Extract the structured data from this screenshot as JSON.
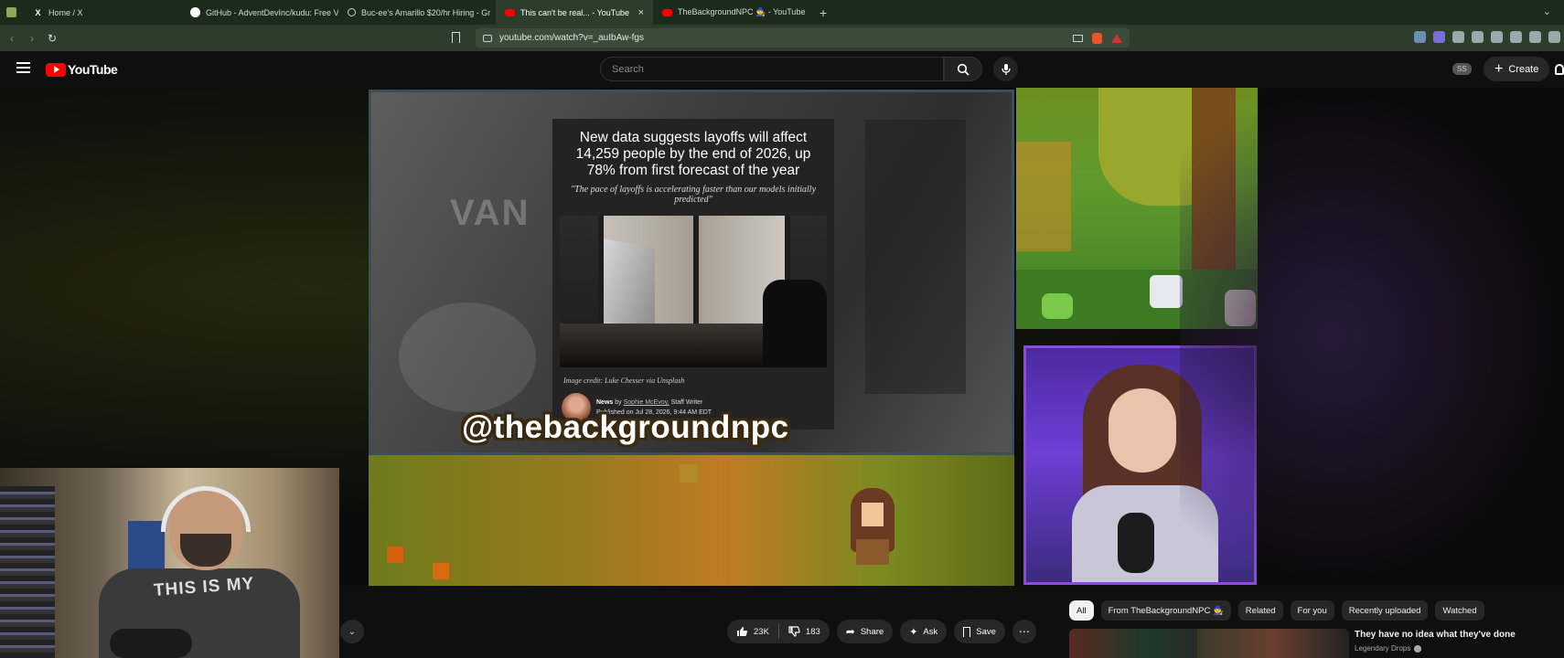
{
  "browser": {
    "tabs": [
      {
        "title": "Home / X",
        "icon": "x-logo-icon",
        "icon_color": "#ffffff"
      },
      {
        "title": "GitHub - AdventDevInc/kudu: Free V",
        "icon": "github-icon",
        "icon_color": "#ffffff"
      },
      {
        "title": "Buc-ee's Amarillo $20/hr Hiring - Gr",
        "icon": "web-icon",
        "icon_color": "#cccccc"
      },
      {
        "title": "This can't be real... - YouTube",
        "icon": "youtube-icon",
        "icon_color": "#ff0000",
        "active": true
      },
      {
        "title": "TheBackgroundNPC 🧙 - YouTube",
        "icon": "youtube-icon",
        "icon_color": "#ff0000"
      }
    ],
    "close_glyph": "×",
    "newtab_glyph": "+",
    "chevron_glyph": "⌄",
    "url": "youtube.com/watch?v=_auIbAw-fgs"
  },
  "youtube": {
    "logo_text": "YouTube",
    "search_placeholder": "Search",
    "ss_badge": "SS",
    "create_label": "Create",
    "accent": "#ff0000"
  },
  "video": {
    "slide_watermark": "VAN",
    "article": {
      "headline": "New data suggests layoffs will affect 14,259 people by the end of 2026, up 78% from first forecast of the year",
      "quote": "\"The pace of layoffs is accelerating faster than our models initially predicted\"",
      "image_credit": "Image credit: Luke Chesser via Unsplash",
      "section": "News",
      "by_prefix": "by",
      "author": "Sophie McEvoy,",
      "role": "Staff Writer",
      "published": "Published on Jul 28, 2026, 9:44 AM EDT"
    },
    "channel_handle": "@thebackgroundnpc",
    "shirt_text": "THIS IS MY"
  },
  "actions": {
    "likes": "23K",
    "dislikes": "183",
    "share": "Share",
    "ask": "Ask",
    "save": "Save",
    "more_glyph": "⋯",
    "expand_glyph": "⌄"
  },
  "chips": [
    "All",
    "From TheBackgroundNPC 🧙",
    "Related",
    "For you",
    "Recently uploaded",
    "Watched"
  ],
  "recommendation": {
    "title": "They have no idea what they've done",
    "channel": "Legendary Drops"
  }
}
